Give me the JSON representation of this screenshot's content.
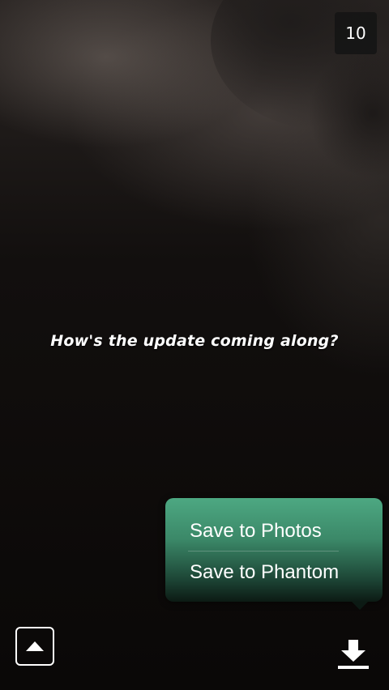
{
  "timer": {
    "seconds": "10"
  },
  "snap": {
    "caption": "How's the update coming along?"
  },
  "save_menu": {
    "items": [
      {
        "label": "Save to Photos"
      },
      {
        "label": "Save to Phantom"
      }
    ],
    "colors": {
      "top": "#4da882",
      "bottom": "#0c1a14"
    }
  },
  "toolbar": {
    "left_icon": "triangle-up-icon",
    "right_icon": "download-icon"
  }
}
